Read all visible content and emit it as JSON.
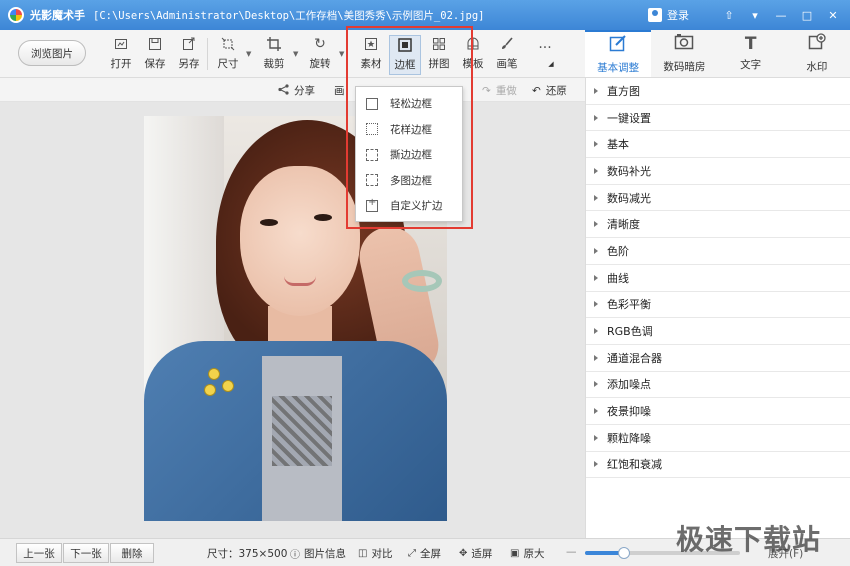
{
  "titlebar": {
    "app_name": "光影魔术手",
    "file_path": "[C:\\Users\\Administrator\\Desktop\\工作存档\\美图秀秀\\示例图片_02.jpg]",
    "login_label": "登录",
    "window_buttons": [
      "⇧",
      "▾",
      "—",
      "□",
      "✕"
    ]
  },
  "toolbar": {
    "browse_label": "浏览图片",
    "items": [
      {
        "label": "打开",
        "icon": "open-icon"
      },
      {
        "label": "保存",
        "icon": "save-icon"
      },
      {
        "label": "另存",
        "icon": "save-as-icon"
      },
      {
        "label": "尺寸",
        "icon": "resize-icon"
      },
      {
        "label": "裁剪",
        "icon": "crop-icon"
      },
      {
        "label": "旋转",
        "icon": "rotate-icon"
      },
      {
        "label": "素材",
        "icon": "material-icon"
      },
      {
        "label": "边框",
        "icon": "frame-icon"
      },
      {
        "label": "拼图",
        "icon": "collage-icon"
      },
      {
        "label": "模板",
        "icon": "template-icon"
      },
      {
        "label": "画笔",
        "icon": "brush-icon"
      },
      {
        "label": "...",
        "icon": "more-icon"
      }
    ]
  },
  "right_tabs": [
    {
      "label": "基本调整",
      "icon": "basic-adjust-icon",
      "active": true
    },
    {
      "label": "数码暗房",
      "icon": "darkroom-icon",
      "active": false
    },
    {
      "label": "文字",
      "icon": "text-icon",
      "active": false
    },
    {
      "label": "水印",
      "icon": "watermark-icon",
      "active": false
    }
  ],
  "subbar": {
    "share_label": "分享",
    "left_partial": "画",
    "redo_label": "重做",
    "restore_label": "还原"
  },
  "frame_menu": {
    "items": [
      {
        "label": "轻松边框",
        "icon": "easy-frame-icon"
      },
      {
        "label": "花样边框",
        "icon": "pattern-frame-icon"
      },
      {
        "label": "撕边边框",
        "icon": "torn-frame-icon"
      },
      {
        "label": "多图边框",
        "icon": "multi-frame-icon"
      },
      {
        "label": "自定义扩边",
        "icon": "custom-expand-icon"
      }
    ]
  },
  "adjust_panel": {
    "items": [
      "直方图",
      "一键设置",
      "基本",
      "数码补光",
      "数码减光",
      "清晰度",
      "色阶",
      "曲线",
      "色彩平衡",
      "RGB色调",
      "通道混合器",
      "添加噪点",
      "夜景抑噪",
      "颗粒降噪",
      "红饱和衰减"
    ]
  },
  "statusbar": {
    "prev_label": "上一张",
    "next_label": "下一张",
    "delete_label": "删除",
    "size_text": "尺寸：375×500",
    "info_label": "图片信息",
    "compare_label": "对比",
    "fullscreen_label": "全屏",
    "fit_label": "适屏",
    "original_label": "原大",
    "zoom_minus": "—",
    "zoom_level": 0.25,
    "expand_label": "展开(F)"
  },
  "watermark_text": "极速下载站",
  "colors": {
    "accent": "#2b7bd3",
    "highlight": "#e33b32",
    "titlebar": "#3d86d6"
  }
}
